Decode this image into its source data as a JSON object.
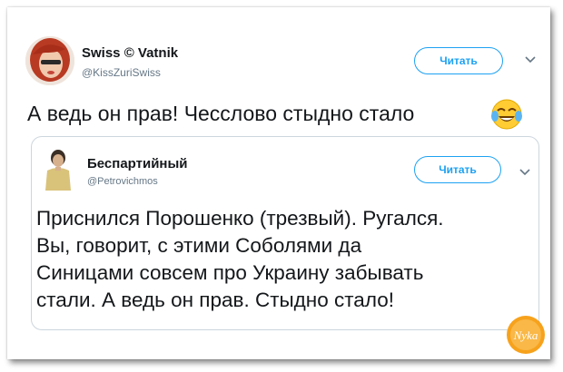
{
  "tweet": {
    "author_name": "Swiss © Vatnik",
    "author_handle": "@KissZuriSwiss",
    "follow_label": "Читать",
    "text": "А ведь он прав! Чесслово стыдно стало",
    "emoji": "face-with-tears-of-joy-icon"
  },
  "quoted": {
    "author_name": "Беспартийный",
    "author_handle": "@Petrovichmos",
    "follow_label": "Читать",
    "lines": [
      "Приснился Порошенко (трезвый). Ругался.",
      "Вы, говорит, с этими Соболями да",
      "Синицами совсем про Украину забывать",
      "стали. А ведь он прав. Стыдно стало!"
    ]
  },
  "watermark": {
    "text": "Nyka"
  },
  "colors": {
    "accent": "#1da1f2",
    "text": "#14171a",
    "muted": "#657786",
    "border": "#ccd6dd"
  }
}
